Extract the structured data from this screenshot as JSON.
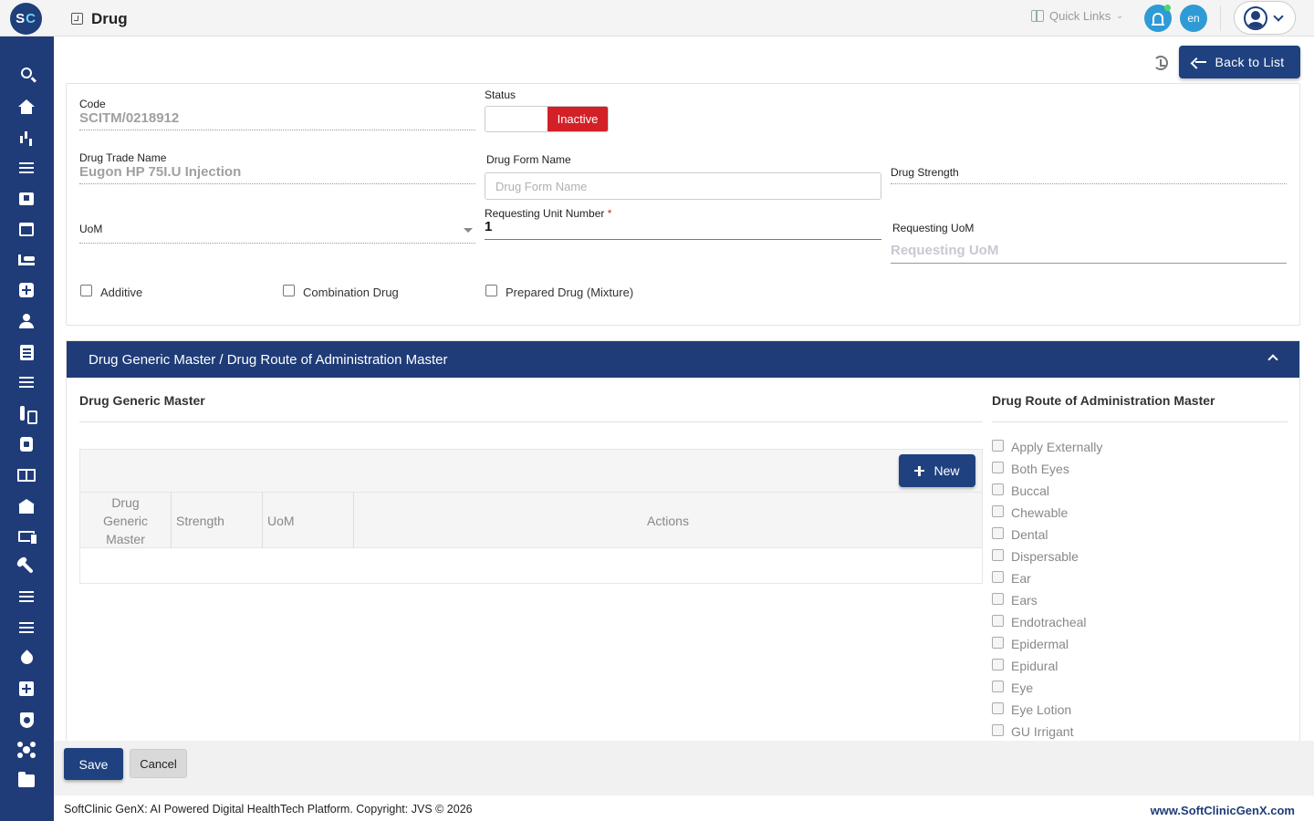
{
  "header": {
    "logo_text": "SC",
    "page_title": "Drug",
    "quick_links_label": "Quick Links",
    "language": "en"
  },
  "sidebar": {
    "items": [
      "search-icon",
      "home-icon",
      "bar-chart-icon",
      "menu-icon",
      "medical-bag-icon",
      "calendar-icon",
      "bed-icon",
      "hospital-plus-icon",
      "person-icon",
      "document-icon",
      "menu-icon",
      "lab-icon",
      "pharmacy-icon",
      "book-icon",
      "bank-icon",
      "devices-icon",
      "wrench-icon",
      "menu-icon",
      "menu-icon",
      "blood-drop-icon",
      "add-box-icon",
      "shield-icon",
      "hub-icon",
      "folder-icon"
    ]
  },
  "actions": {
    "back_label": "Back to List"
  },
  "form": {
    "code_label": "Code",
    "code_value": "SCITM/0218912",
    "status_label": "Status",
    "status_value": "Inactive",
    "trade_name_label": "Drug Trade Name",
    "trade_name_value": "Eugon HP 75I.U Injection",
    "form_name_label": "Drug Form Name",
    "form_name_placeholder": "Drug Form Name",
    "strength_label": "Drug Strength",
    "uom_label": "UoM",
    "req_unit_label": "Requesting Unit Number",
    "req_unit_required": "*",
    "req_unit_value": "1",
    "req_uom_label": "Requesting UoM",
    "req_uom_placeholder": "Requesting UoM",
    "checkboxes": {
      "additive": "Additive",
      "combination": "Combination Drug",
      "prepared": "Prepared Drug (Mixture)"
    }
  },
  "section": {
    "title": "Drug Generic Master  / Drug Route of Administration Master",
    "generic_title": "Drug Generic Master",
    "route_title": "Drug Route of Administration Master",
    "new_label": "New",
    "columns": {
      "generic": "Drug Generic Master",
      "strength": "Strength",
      "uom": "UoM",
      "actions": "Actions"
    },
    "routes": [
      "Apply Externally",
      "Both Eyes",
      "Buccal",
      "Chewable",
      "Dental",
      "Dispersable",
      "Ear",
      "Ears",
      "Endotracheal",
      "Epidermal",
      "Epidural",
      "Eye",
      "Eye Lotion",
      "GU Irrigant"
    ]
  },
  "footer": {
    "save_label": "Save",
    "cancel_label": "Cancel",
    "copyright": "SoftClinic GenX: AI Powered Digital HealthTech Platform. Copyright: JVS © 2026",
    "website": "www.SoftClinicGenX.com"
  },
  "colors": {
    "primary": "#1f3c78",
    "danger": "#d32027",
    "accent": "#2e9bd6"
  }
}
